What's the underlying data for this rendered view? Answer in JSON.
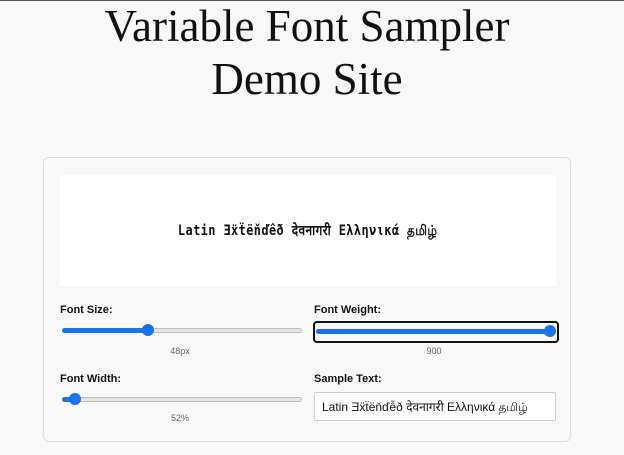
{
  "page": {
    "title_line1": "Variable Font Sampler",
    "title_line2": "Demo Site"
  },
  "preview": {
    "text": "Latin Ǝẍẗëňďễð देवनागरी Ελληνικά தமிழ்"
  },
  "controls": {
    "font_size": {
      "label": "Font Size:",
      "value_text": "48px",
      "level": 0.35
    },
    "font_weight": {
      "label": "Font Weight:",
      "value_text": "900",
      "level": 1.0
    },
    "font_width": {
      "label": "Font Width:",
      "value_text": "52%",
      "level": 0.03
    },
    "sample_text": {
      "label": "Sample Text:",
      "value": "Latin Ǝẍẗëňďễð देवनागरी Ελληνικά தமிழ்"
    }
  },
  "colors": {
    "accent": "#1a73e8",
    "track": "#e4e4e4"
  }
}
